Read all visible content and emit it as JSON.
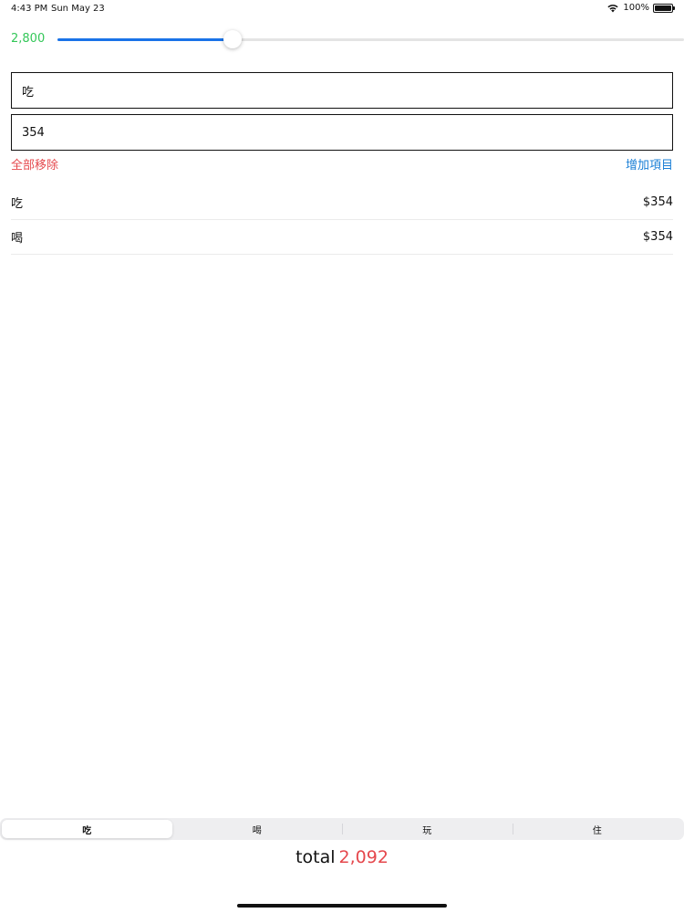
{
  "status_bar": {
    "time": "4:43 PM",
    "date": "Sun May 23",
    "battery": "100%",
    "battery_level": 1.0,
    "icons": [
      "wifi-icon",
      "battery-icon"
    ]
  },
  "slider": {
    "value_label": "2,800",
    "level": 0.28,
    "value_color": "#34c759",
    "fill_color": "#1a73e8"
  },
  "form": {
    "name_value": "吃",
    "amount_value": "354"
  },
  "actions": {
    "remove_all_label": "全部移除",
    "remove_all_color": "#e5484d",
    "add_item_label": "增加項目",
    "add_item_color": "#1a7fd6"
  },
  "items": [
    {
      "name": "吃",
      "amount": "$354"
    },
    {
      "name": "喝",
      "amount": "$354"
    }
  ],
  "segments": [
    {
      "label": "吃",
      "selected": true
    },
    {
      "label": "喝",
      "selected": false
    },
    {
      "label": "玩",
      "selected": false
    },
    {
      "label": "住",
      "selected": false
    }
  ],
  "total": {
    "label": "total",
    "value": "2,092",
    "value_color": "#e5484d"
  }
}
